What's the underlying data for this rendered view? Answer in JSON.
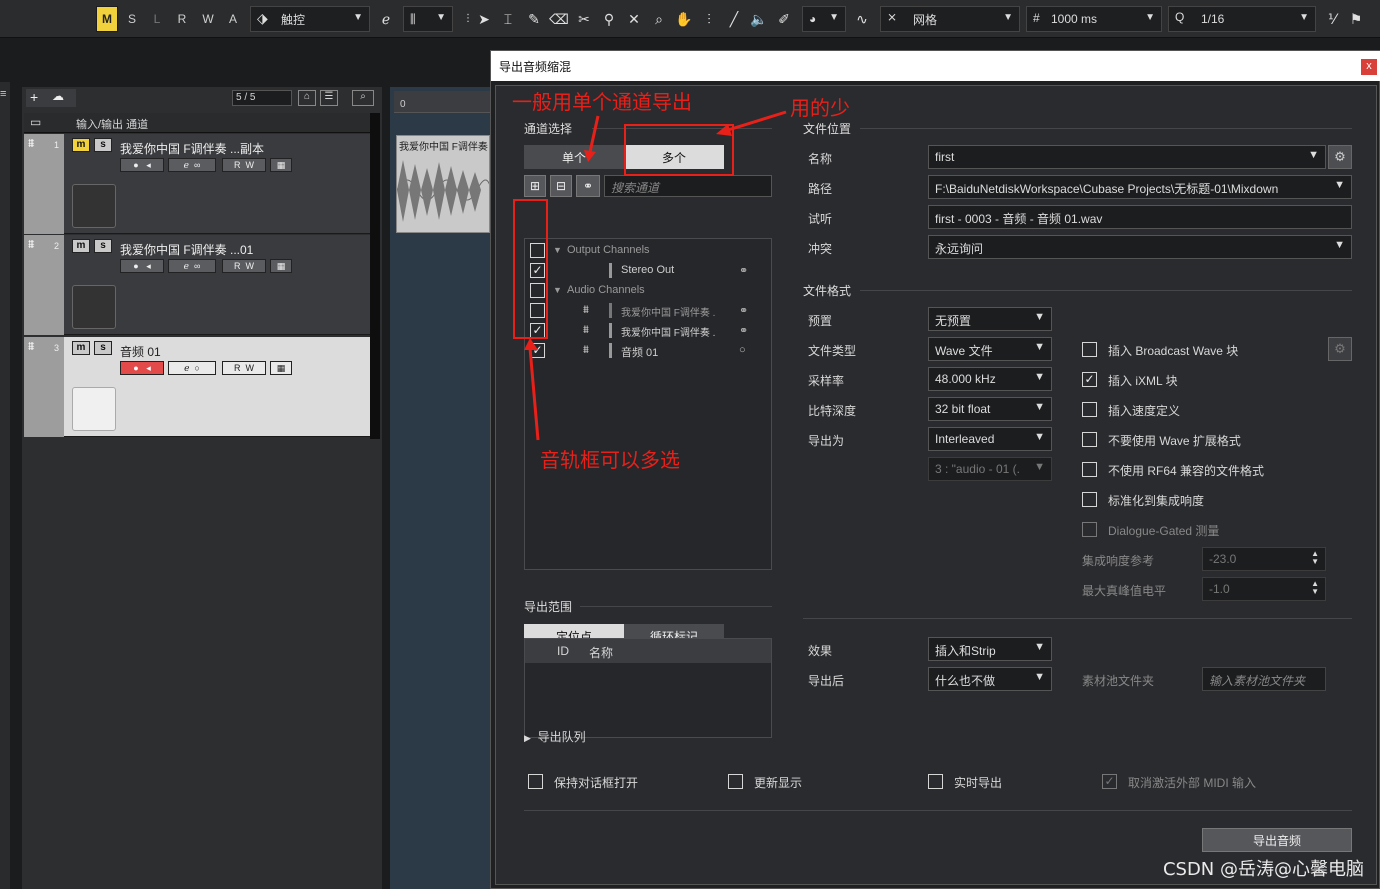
{
  "toolbar": {
    "modes": [
      "M",
      "S",
      "L",
      "R",
      "W",
      "A"
    ],
    "touch_mode": "触控",
    "grid_type": "网格",
    "nudge": "1000 ms",
    "quantize": "1/16"
  },
  "project": {
    "track_count": "5 / 5",
    "io_label": "输入/输出 通道",
    "tracks": [
      {
        "num": "1",
        "name": "我爱你中国 F调伴奏 ...副本"
      },
      {
        "num": "2",
        "name": "我爱你中国 F调伴奏 ...01"
      },
      {
        "num": "3",
        "name": "音频 01"
      }
    ],
    "clip_label": "我爱你中国 F调伴奏",
    "ruler_start": "0"
  },
  "dialog": {
    "title": "导出音频缩混",
    "close": "x",
    "channel_section": "通道选择",
    "tab_single": "单个",
    "tab_multi": "多个",
    "search_placeholder": "搜索通道",
    "channels": {
      "output_group": "Output Channels",
      "stereo_out": "Stereo Out",
      "audio_group": "Audio Channels",
      "audio1": "我爱你中国 F调伴奏 .",
      "audio2": "我爱你中国 F调伴奏 .",
      "audio3": "音频 01"
    },
    "range_section": "导出范围",
    "range_tab1": "定位点",
    "range_tab2": "循环标记",
    "range_col_id": "ID",
    "range_col_name": "名称",
    "file_location": "文件位置",
    "name_label": "名称",
    "name_value": "first",
    "path_label": "路径",
    "path_value": "F:\\BaiduNetdiskWorkspace\\Cubase Projects\\无标题-01\\Mixdown",
    "preview_label": "试听",
    "preview_value": "first - 0003 - 音频 - 音频 01.wav",
    "conflict_label": "冲突",
    "conflict_value": "永远询问",
    "file_format": "文件格式",
    "preset_label": "预置",
    "preset_value": "无预置",
    "filetype_label": "文件类型",
    "filetype_value": "Wave 文件",
    "samplerate_label": "采样率",
    "samplerate_value": "48.000 kHz",
    "bitdepth_label": "比特深度",
    "bitdepth_value": "32 bit float",
    "exportas_label": "导出为",
    "exportas_value": "Interleaved",
    "channel_map_value": "3 : \"audio - 01 (.",
    "opt_broadcast": "插入 Broadcast Wave 块",
    "opt_ixml": "插入 iXML 块",
    "opt_tempo": "插入速度定义",
    "opt_no_wave_ext": "不要使用 Wave 扩展格式",
    "opt_no_rf64": "不使用 RF64 兼容的文件格式",
    "opt_normalize": "标准化到集成响度",
    "opt_dialogue": "Dialogue-Gated 测量",
    "loudness_ref_label": "集成响度参考",
    "loudness_ref_value": "-23.0",
    "true_peak_label": "最大真峰值电平",
    "true_peak_value": "-1.0",
    "effects_label": "效果",
    "effects_value": "插入和Strip",
    "after_label": "导出后",
    "after_value": "什么也不做",
    "pool_label": "素材池文件夹",
    "pool_placeholder": "输入素材池文件夹",
    "queue": "导出队列",
    "keep_open": "保持对话框打开",
    "update_display": "更新显示",
    "realtime": "实时导出",
    "deactivate_midi": "取消激活外部 MIDI 输入",
    "export_btn": "导出音频"
  },
  "annotations": {
    "single_tip": "一般用单个通道导出",
    "multi_tip": "用的少",
    "multi_select_tip": "音轨框可以多选",
    "watermark": "CSDN @岳涛@心馨电脑"
  }
}
